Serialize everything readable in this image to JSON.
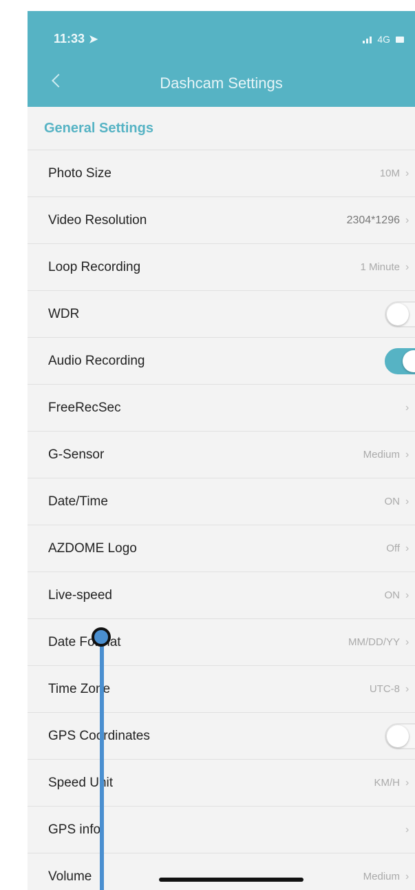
{
  "status_bar": {
    "time": "11:33",
    "location_icon": "location-arrow-icon",
    "network": "4G"
  },
  "header": {
    "title": "Dashcam Settings"
  },
  "section": {
    "title": "General Settings"
  },
  "settings": [
    {
      "label": "Photo Size",
      "value": "10M",
      "type": "link"
    },
    {
      "label": "Video Resolution",
      "value": "2304*1296",
      "type": "link"
    },
    {
      "label": "Loop Recording",
      "value": "1 Minute",
      "type": "link"
    },
    {
      "label": "WDR",
      "value": "off",
      "type": "toggle"
    },
    {
      "label": "Audio Recording",
      "value": "on",
      "type": "toggle"
    },
    {
      "label": "FreeRecSec",
      "value": "",
      "type": "link"
    },
    {
      "label": "G-Sensor",
      "value": "Medium",
      "type": "link"
    },
    {
      "label": "Date/Time",
      "value": "ON",
      "type": "link"
    },
    {
      "label": "AZDOME Logo",
      "value": "Off",
      "type": "link"
    },
    {
      "label": "Live-speed",
      "value": "ON",
      "type": "link"
    },
    {
      "label": "Date Format",
      "value": "MM/DD/YY",
      "type": "link"
    },
    {
      "label": "Time Zone",
      "value": "UTC-8",
      "type": "link"
    },
    {
      "label": "GPS Coordinates",
      "value": "off",
      "type": "toggle"
    },
    {
      "label": "Speed Unit",
      "value": "KM/H",
      "type": "link"
    },
    {
      "label": "GPS info",
      "value": "",
      "type": "link"
    },
    {
      "label": "Volume",
      "value": "Medium",
      "type": "link"
    }
  ],
  "colors": {
    "accent": "#56b3c4",
    "pointer": "#4a8fd0"
  }
}
